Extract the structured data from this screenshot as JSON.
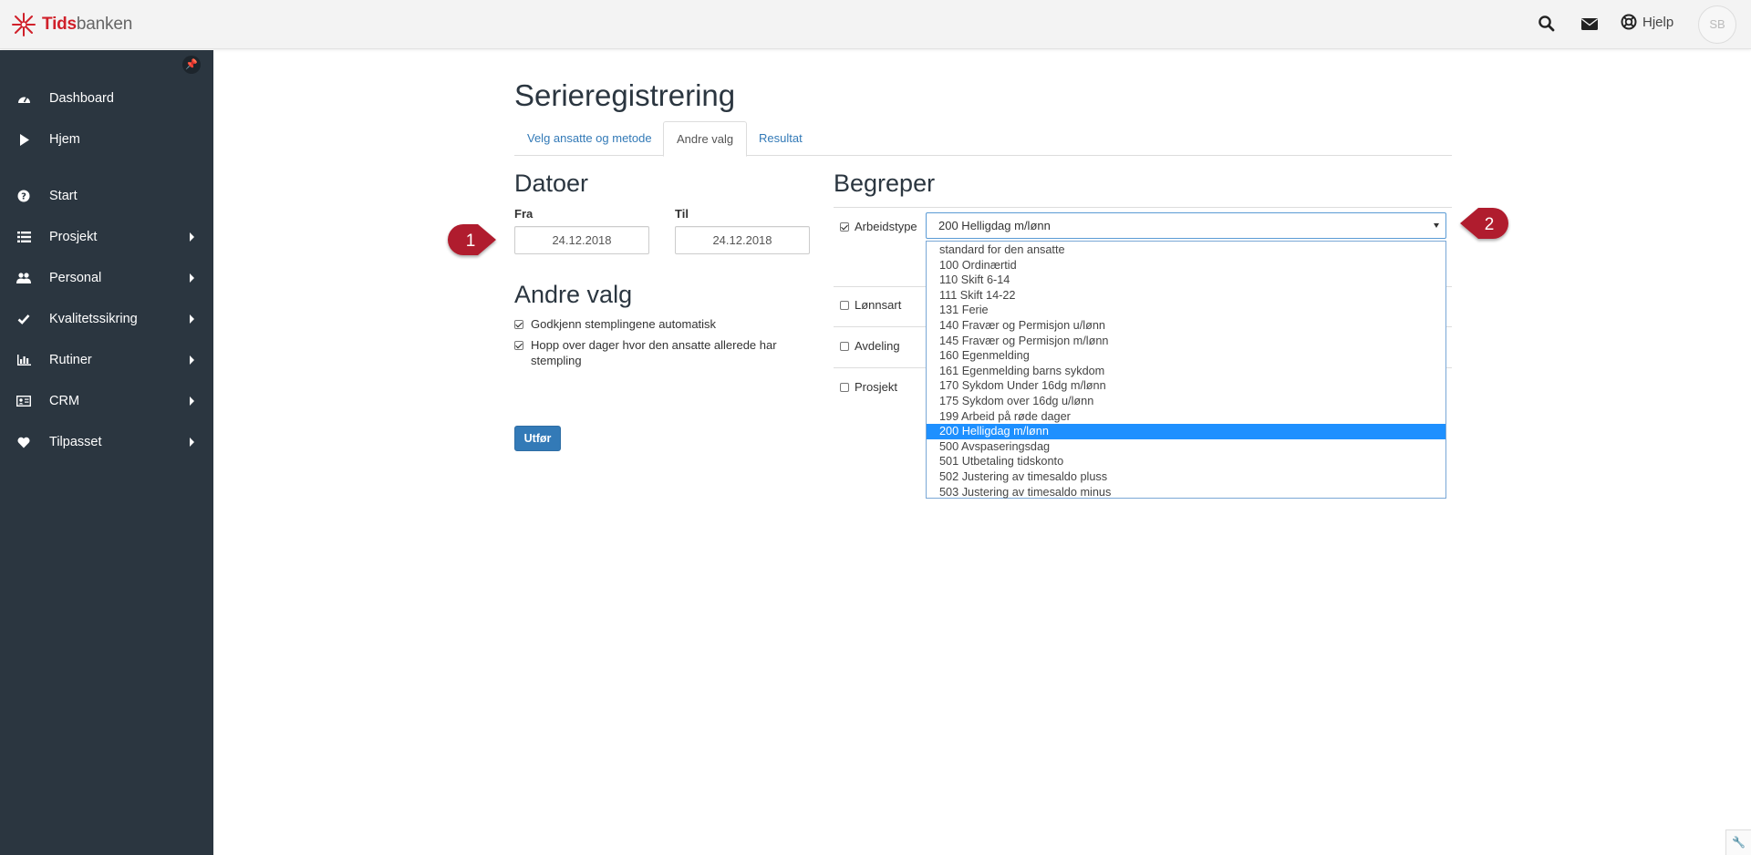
{
  "header": {
    "logo_part1": "Tids",
    "logo_part2": "banken",
    "help_label": "Hjelp",
    "avatar_initials": "SB",
    "icons": [
      "search-icon",
      "envelope-icon",
      "lifebuoy-icon"
    ]
  },
  "sidebar": {
    "items": [
      {
        "label": "Dashboard",
        "icon": "dashboard-icon",
        "submenu": false
      },
      {
        "label": "Hjem",
        "icon": "play-icon",
        "submenu": false
      },
      {
        "label": "Start",
        "icon": "question-circle-icon",
        "submenu": false
      },
      {
        "label": "Prosjekt",
        "icon": "list-icon",
        "submenu": true
      },
      {
        "label": "Personal",
        "icon": "users-icon",
        "submenu": true
      },
      {
        "label": "Kvalitetssikring",
        "icon": "check-icon",
        "submenu": true
      },
      {
        "label": "Rutiner",
        "icon": "bar-chart-icon",
        "submenu": true
      },
      {
        "label": "CRM",
        "icon": "id-card-icon",
        "submenu": true
      },
      {
        "label": "Tilpasset",
        "icon": "heart-icon",
        "submenu": true
      }
    ]
  },
  "page": {
    "title": "Serieregistrering",
    "tabs": [
      {
        "label": "Velg ansatte og metode",
        "active": false
      },
      {
        "label": "Andre valg",
        "active": true
      },
      {
        "label": "Resultat",
        "active": false
      }
    ]
  },
  "dates": {
    "heading": "Datoer",
    "from_label": "Fra",
    "from_value": "24.12.2018",
    "to_label": "Til",
    "to_value": "24.12.2018"
  },
  "other_options": {
    "heading": "Andre valg",
    "options": [
      {
        "label": "Godkjenn stemplingene automatisk",
        "checked": true
      },
      {
        "label_line1": "Hopp over dager hvor den ansatte allerede har",
        "label_line2": "stempling",
        "checked": true
      }
    ]
  },
  "run_button": "Utfør",
  "concepts": {
    "heading": "Begreper",
    "rows": [
      {
        "label": "Arbeidstype",
        "checked": true
      },
      {
        "label": "Lønnsart",
        "checked": false
      },
      {
        "label": "Avdeling",
        "checked": false
      },
      {
        "label": "Prosjekt",
        "checked": false
      }
    ],
    "select_value": "200 Helligdag m/lønn",
    "options": [
      "standard for den ansatte",
      "100 Ordinærtid",
      "110 Skift 6-14",
      "111 Skift 14-22",
      "131 Ferie",
      "140 Fravær og Permisjon u/lønn",
      "145 Fravær og Permisjon m/lønn",
      "160 Egenmelding",
      "161 Egenmelding barns sykdom",
      "170 Sykdom Under 16dg m/lønn",
      "175 Sykdom over 16dg u/lønn",
      "199 Arbeid på røde dager",
      "200 Helligdag m/lønn",
      "500 Avspaseringsdag",
      "501 Utbetaling tidskonto",
      "502 Justering av timesaldo pluss",
      "503 Justering av timesaldo minus"
    ],
    "selected_option": "200 Helligdag m/lønn"
  },
  "markers": [
    "1",
    "2"
  ],
  "colors": {
    "sidebar": "#2b3640",
    "primary": "#337ab7",
    "selection": "#1e90ff",
    "marker": "#b01e2e",
    "brand": "#d0202a"
  }
}
